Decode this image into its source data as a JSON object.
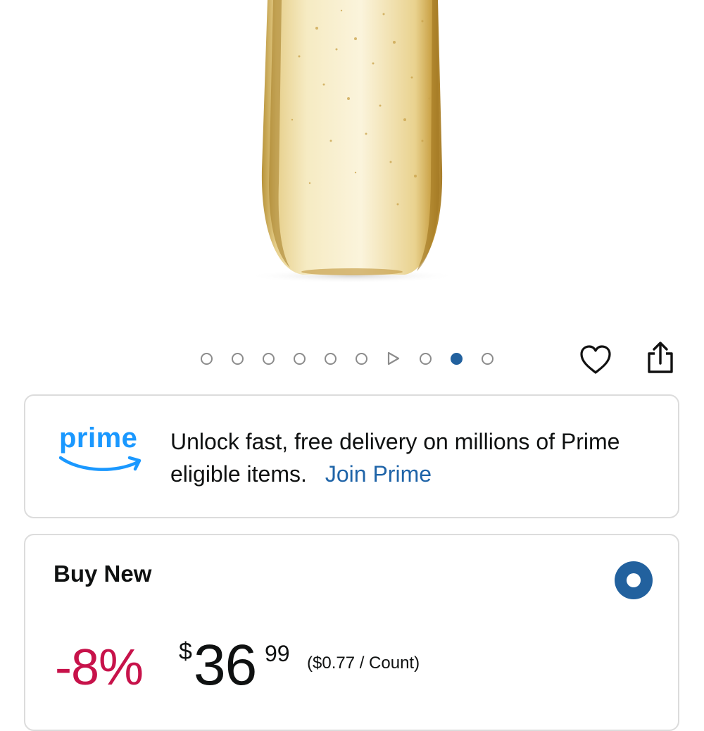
{
  "product": {
    "image_icon": "champagne-flute-image"
  },
  "carousel": {
    "dots": [
      "",
      "",
      "",
      "",
      "",
      "",
      "play",
      "",
      "active",
      ""
    ],
    "play_icon": "play-icon"
  },
  "actions": {
    "wishlist_icon": "heart-icon",
    "share_icon": "share-icon"
  },
  "prime": {
    "logo_word": "prime",
    "message": "Unlock fast, free delivery on millions of Prime eligible items.",
    "join_link": "Join Prime",
    "brand_color": "#1a98ff",
    "link_color": "#1f64a8"
  },
  "buy_box": {
    "title": "Buy New",
    "discount": "-8%",
    "currency_symbol": "$",
    "price_whole": "36",
    "price_fraction": "99",
    "unit_price": "($0.77 / Count)",
    "discount_color": "#c7124a",
    "selected_color": "#22619e"
  }
}
